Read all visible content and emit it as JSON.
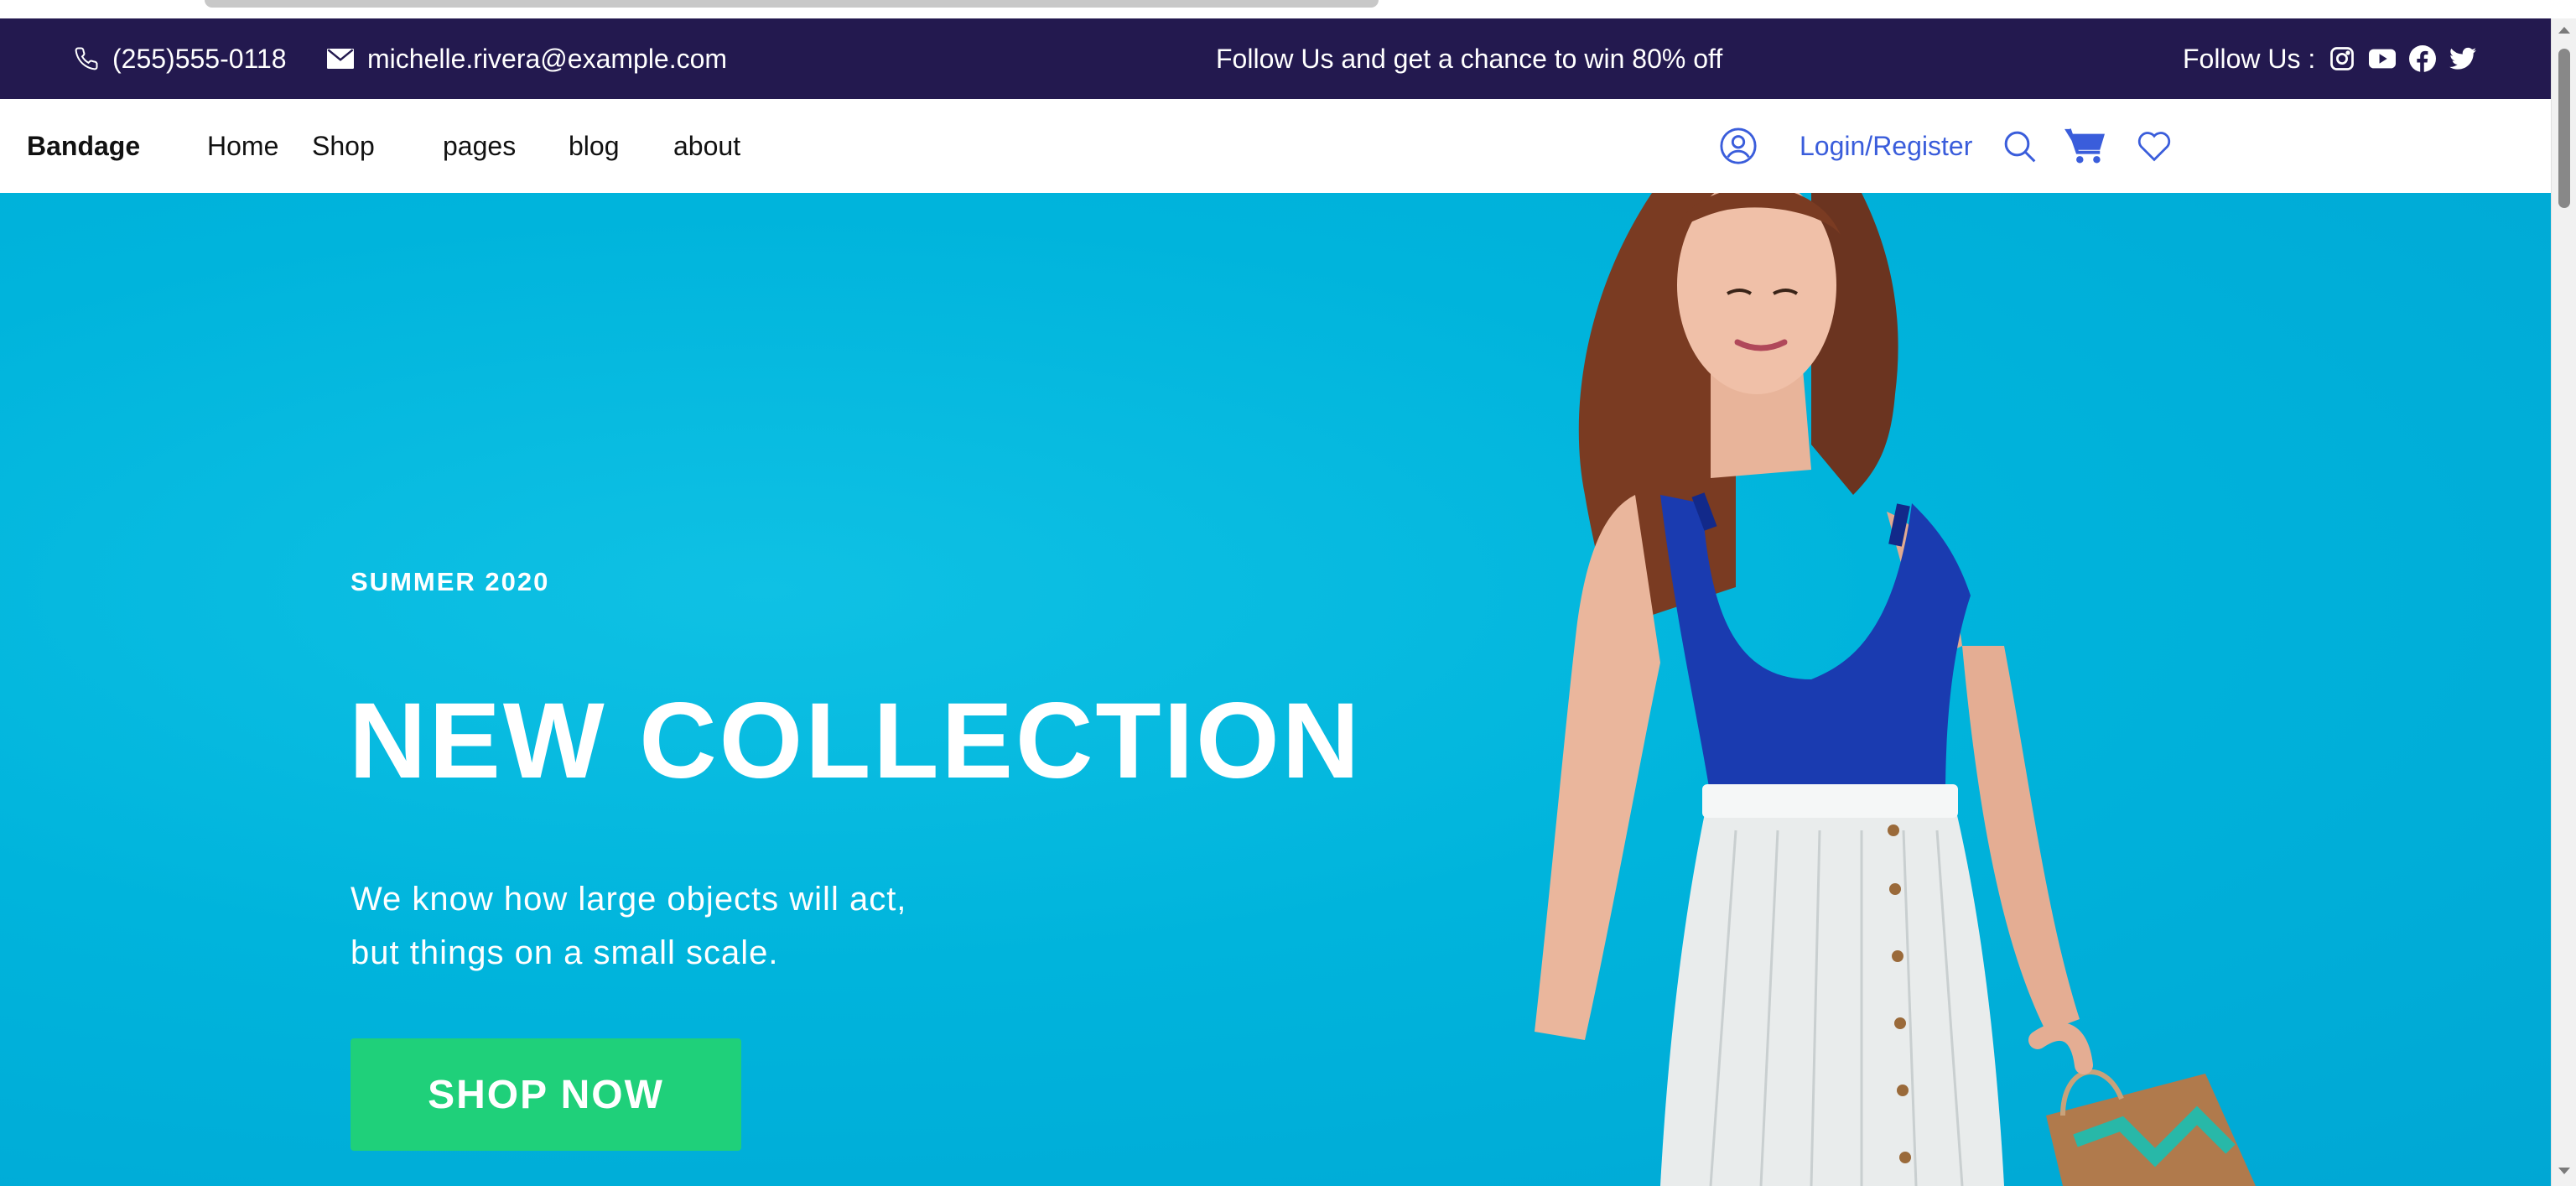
{
  "topbar": {
    "phone": "(255)555-0118",
    "email": "michelle.rivera@example.com",
    "promo": "Follow Us and get a chance to win 80% off",
    "follow_label": "Follow Us :",
    "socials": [
      "instagram-icon",
      "youtube-icon",
      "facebook-icon",
      "twitter-icon"
    ],
    "background": "#23194f"
  },
  "navbar": {
    "brand": "Bandage",
    "links": [
      "Home",
      "Shop",
      "pages",
      "blog",
      "about"
    ],
    "login": "Login/Register",
    "icons": [
      "user-icon",
      "search-icon",
      "cart-icon",
      "heart-icon"
    ],
    "accent": "#3a5ddb"
  },
  "hero": {
    "season": "SUMMER 2020",
    "headline": "NEW COLLECTION",
    "desc_line1": "We know how large objects will act,",
    "desc_line2": "but things on a small scale.",
    "cta": "SHOP NOW",
    "background": "#00b4dc",
    "cta_color": "#1fd07a"
  }
}
